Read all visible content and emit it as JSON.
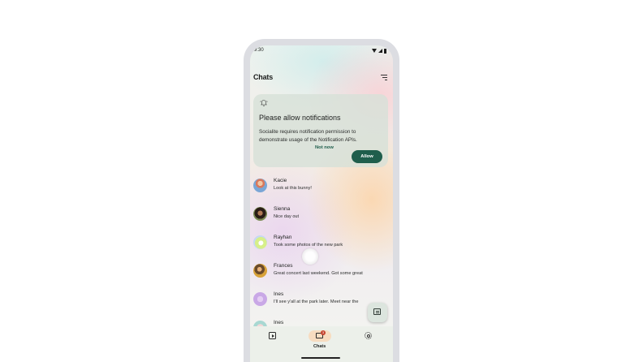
{
  "status_bar": {
    "time": "9:30"
  },
  "header": {
    "title": "Chats",
    "filter_icon": "filter-list-icon"
  },
  "permission_card": {
    "icon": "bell-alert-icon",
    "heading": "Please allow notifications",
    "body": "Socialite requires notification permission to demonstrate usage of the Notification APIs.",
    "secondary_label": "Not now",
    "primary_label": "Allow",
    "accent": "#1f5e4c"
  },
  "chats": [
    {
      "name": "Kacie",
      "message": "Look at this bunny!"
    },
    {
      "name": "Sienna",
      "message": "Nice day out"
    },
    {
      "name": "Rayhan",
      "message": "Took some photos of the new park"
    },
    {
      "name": "Frances",
      "message": "Great concert last weekend. Got some great"
    },
    {
      "name": "Ines",
      "message": "I'll see y'all at the park later. Meet near the"
    },
    {
      "name": "Ines",
      "message": ""
    }
  ],
  "fab": {
    "icon": "new-message-icon"
  },
  "bottom_nav": {
    "items": [
      {
        "icon": "video-library-icon",
        "label": ""
      },
      {
        "icon": "chat-bubble-icon",
        "label": "Chats",
        "badge": "3"
      },
      {
        "icon": "gear-icon",
        "label": ""
      }
    ],
    "selected_color": "#f7dcc0"
  }
}
